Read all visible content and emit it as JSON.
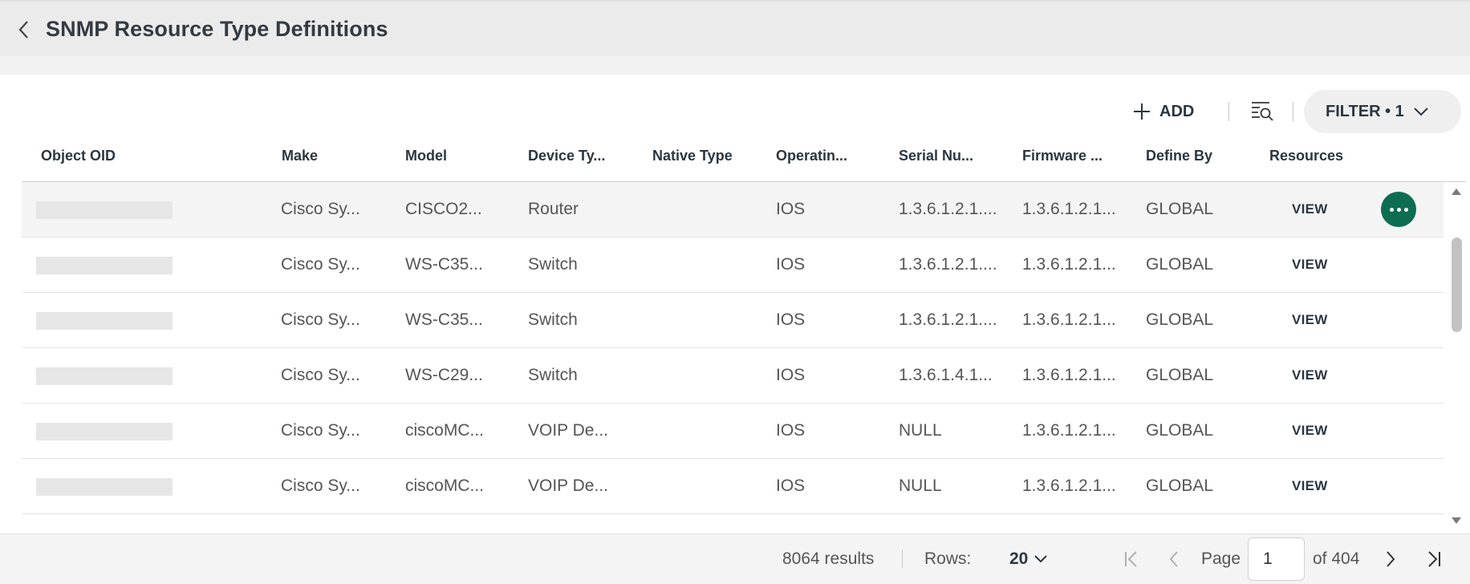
{
  "header": {
    "title": "SNMP Resource Type Definitions"
  },
  "toolbar": {
    "add_label": "ADD",
    "filter_label": "FILTER • 1"
  },
  "table": {
    "columns": [
      "Object OID",
      "Make",
      "Model",
      "Device Ty...",
      "Native Type",
      "Operatin...",
      "Serial Nu...",
      "Firmware ...",
      "Define By",
      "Resources"
    ],
    "rows": [
      {
        "make": "Cisco Sy...",
        "model": "CISCO2...",
        "device_type": "Router",
        "native_type": "",
        "os": "IOS",
        "serial": "1.3.6.1.2.1....",
        "firmware": "1.3.6.1.2.1...",
        "define_by": "GLOBAL",
        "resources": "VIEW"
      },
      {
        "make": "Cisco Sy...",
        "model": "WS-C35...",
        "device_type": "Switch",
        "native_type": "",
        "os": "IOS",
        "serial": "1.3.6.1.2.1....",
        "firmware": "1.3.6.1.2.1...",
        "define_by": "GLOBAL",
        "resources": "VIEW"
      },
      {
        "make": "Cisco Sy...",
        "model": "WS-C35...",
        "device_type": "Switch",
        "native_type": "",
        "os": "IOS",
        "serial": "1.3.6.1.2.1....",
        "firmware": "1.3.6.1.2.1...",
        "define_by": "GLOBAL",
        "resources": "VIEW"
      },
      {
        "make": "Cisco Sy...",
        "model": "WS-C29...",
        "device_type": "Switch",
        "native_type": "",
        "os": "IOS",
        "serial": "1.3.6.1.4.1...",
        "firmware": "1.3.6.1.2.1...",
        "define_by": "GLOBAL",
        "resources": "VIEW"
      },
      {
        "make": "Cisco Sy...",
        "model": "ciscoMC...",
        "device_type": "VOIP De...",
        "native_type": "",
        "os": "IOS",
        "serial": "NULL",
        "firmware": "1.3.6.1.2.1...",
        "define_by": "GLOBAL",
        "resources": "VIEW"
      },
      {
        "make": "Cisco Sy...",
        "model": "ciscoMC...",
        "device_type": "VOIP De...",
        "native_type": "",
        "os": "IOS",
        "serial": "NULL",
        "firmware": "1.3.6.1.2.1...",
        "define_by": "GLOBAL",
        "resources": "VIEW"
      }
    ]
  },
  "footer": {
    "results": "8064 results",
    "rows_label": "Rows:",
    "rows_value": "20",
    "page_label": "Page",
    "page_value": "1",
    "page_total": "of 404"
  },
  "colors": {
    "accent": "#0d6d52",
    "header_bg": "#ebebeb",
    "text_dark": "#2b3640"
  },
  "icons": {
    "back": "chevron-left-icon",
    "add": "plus-icon",
    "search_list": "search-list-icon",
    "filter_chevron": "chevron-down-icon",
    "row_more": "more-horizontal-icon",
    "pagination": [
      "first-page-icon",
      "prev-page-icon",
      "next-page-icon",
      "last-page-icon"
    ]
  }
}
